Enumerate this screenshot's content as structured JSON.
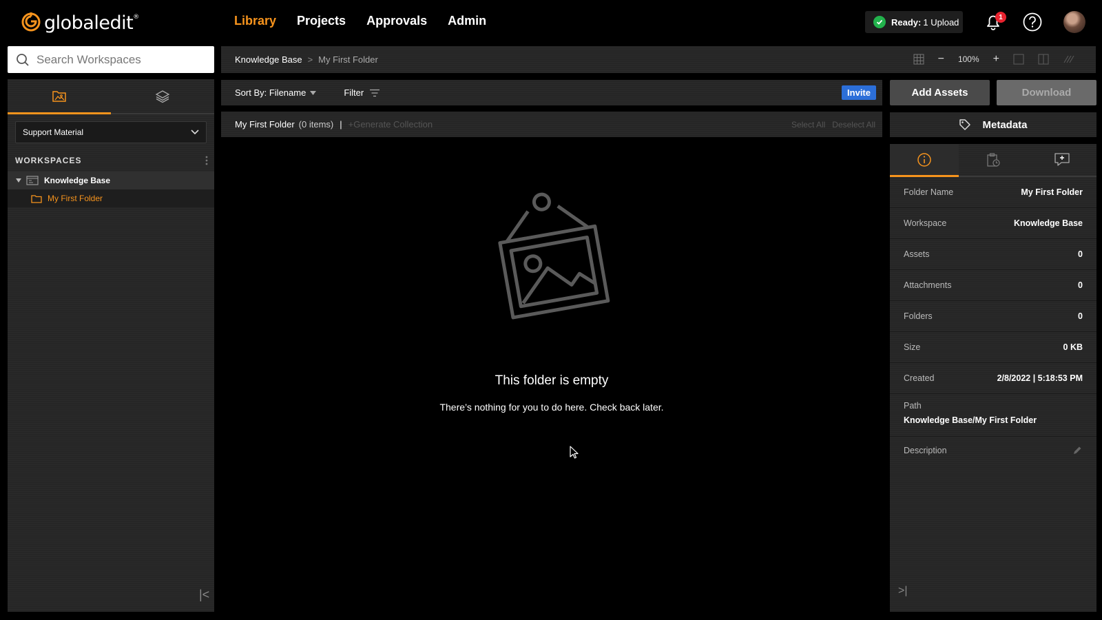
{
  "brand": {
    "name": "globaledit",
    "trademark": "®",
    "accent": "#f7941d"
  },
  "nav": {
    "items": [
      "Library",
      "Projects",
      "Approvals",
      "Admin"
    ],
    "active": "Library"
  },
  "status": {
    "bold": "Ready:",
    "text": "1 Upload"
  },
  "notifications": {
    "count": "1"
  },
  "search": {
    "placeholder": "Search Workspaces"
  },
  "breadcrumb": {
    "parent": "Knowledge Base",
    "separator": ">",
    "current": "My First Folder"
  },
  "view_tools": {
    "zoom": "100%",
    "minus": "−",
    "plus": "+"
  },
  "sidebar": {
    "workspace_select": "Support Material",
    "heading": "WORKSPACES",
    "tree": {
      "workspace": "Knowledge Base",
      "folder": "My First Folder"
    }
  },
  "toolbar": {
    "sort_label": "Sort By: Filename",
    "filter_label": "Filter",
    "invite_label": "Invite"
  },
  "folder_bar": {
    "name": "My First Folder",
    "count": "(0 items)",
    "separator": "|",
    "generate": "+Generate Collection",
    "select_all": "Select All",
    "deselect_all": "Deselect All"
  },
  "empty_state": {
    "title": "This folder is empty",
    "subtitle": "There’s nothing for you to do here. Check back later."
  },
  "actions": {
    "add_assets": "Add Assets",
    "download": "Download"
  },
  "metadata": {
    "title": "Metadata",
    "rows": [
      {
        "key": "Folder Name",
        "value": "My First Folder"
      },
      {
        "key": "Workspace",
        "value": "Knowledge Base"
      },
      {
        "key": "Assets",
        "value": "0"
      },
      {
        "key": "Attachments",
        "value": "0"
      },
      {
        "key": "Folders",
        "value": "0"
      },
      {
        "key": "Size",
        "value": "0 KB"
      },
      {
        "key": "Created",
        "value": "2/8/2022 | 5:18:53 PM"
      }
    ],
    "path_label": "Path",
    "path_value": "Knowledge Base/My First Folder",
    "description_label": "Description"
  }
}
